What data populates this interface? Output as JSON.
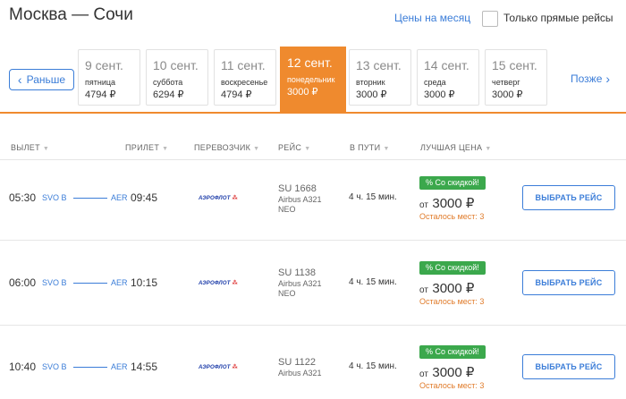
{
  "header": {
    "route": "Москва — Сочи",
    "month_prices_link": "Цены на месяц",
    "direct_only_label": "Только прямые рейсы"
  },
  "date_nav": {
    "earlier_label": "Раньше",
    "later_label": "Позже",
    "dates": [
      {
        "date": "9 сент.",
        "weekday": "пятница",
        "price": "4794 ₽",
        "active": false
      },
      {
        "date": "10 сент.",
        "weekday": "суббота",
        "price": "6294 ₽",
        "active": false
      },
      {
        "date": "11 сент.",
        "weekday": "воскресенье",
        "price": "4794 ₽",
        "active": false
      },
      {
        "date": "12 сент.",
        "weekday": "понедельник",
        "price": "3000 ₽",
        "active": true
      },
      {
        "date": "13 сент.",
        "weekday": "вторник",
        "price": "3000 ₽",
        "active": false
      },
      {
        "date": "14 сент.",
        "weekday": "среда",
        "price": "3000 ₽",
        "active": false
      },
      {
        "date": "15 сент.",
        "weekday": "четверг",
        "price": "3000 ₽",
        "active": false
      }
    ]
  },
  "columns": {
    "departure": "ВЫЛЕТ",
    "arrival": "ПРИЛЕТ",
    "carrier": "ПЕРЕВОЗЧИК",
    "flight": "РЕЙС",
    "duration": "В ПУТИ",
    "best_price": "ЛУЧШАЯ ЦЕНА"
  },
  "flights": [
    {
      "dep_time": "05:30",
      "dep_airport": "SVO B",
      "arr_airport": "AER",
      "arr_time": "09:45",
      "airline": "АЭРОФЛОТ",
      "flight_no": "SU 1668",
      "aircraft": "Airbus A321",
      "aircraft_line2": "NEO",
      "duration": "4 ч. 15 мин.",
      "badge": "% Со скидкой!",
      "price_from": "от",
      "price": "3000 ₽",
      "seats": "Осталось мест: 3",
      "button": "ВЫБРАТЬ РЕЙС"
    },
    {
      "dep_time": "06:00",
      "dep_airport": "SVO B",
      "arr_airport": "AER",
      "arr_time": "10:15",
      "airline": "АЭРОФЛОТ",
      "flight_no": "SU 1138",
      "aircraft": "Airbus A321",
      "aircraft_line2": "NEO",
      "duration": "4 ч. 15 мин.",
      "badge": "% Со скидкой!",
      "price_from": "от",
      "price": "3000 ₽",
      "seats": "Осталось мест: 3",
      "button": "ВЫБРАТЬ РЕЙС"
    },
    {
      "dep_time": "10:40",
      "dep_airport": "SVO B",
      "arr_airport": "AER",
      "arr_time": "14:55",
      "airline": "АЭРОФЛОТ",
      "flight_no": "SU 1122",
      "aircraft": "Airbus A321",
      "aircraft_line2": "",
      "duration": "4 ч. 15 мин.",
      "badge": "% Со скидкой!",
      "price_from": "от",
      "price": "3000 ₽",
      "seats": "Осталось мест: 3",
      "button": "ВЫБРАТЬ РЕЙС"
    }
  ],
  "colors": {
    "accent_orange": "#ef8a2e",
    "link_blue": "#3b7dd8",
    "discount_green": "#3ba84c",
    "seats_orange": "#e07b2a"
  }
}
